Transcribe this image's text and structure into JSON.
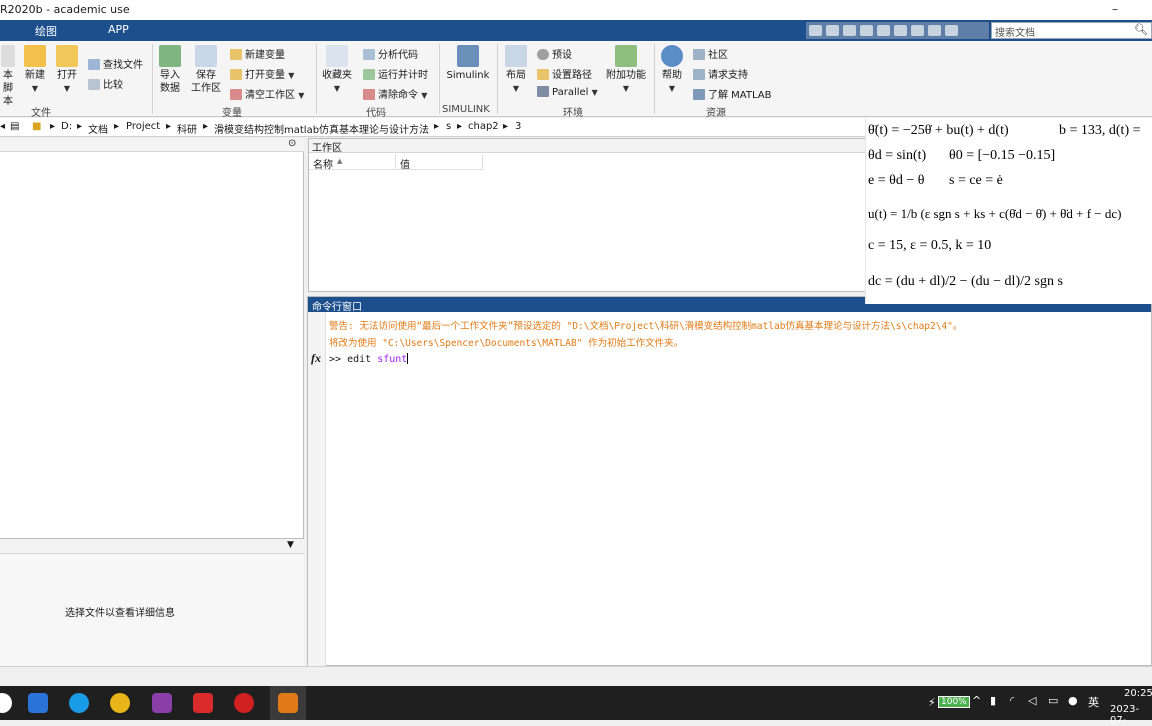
{
  "window": {
    "title": "R2020b - academic use"
  },
  "tabs": [
    "绘图",
    "APP"
  ],
  "search": {
    "placeholder": "搜索文档"
  },
  "ribbon": {
    "groups": {
      "file": {
        "label": "文件",
        "script_partial": "本",
        "script_partial2": "脚本",
        "new": "新建",
        "open": "打开",
        "find_files": "查找文件",
        "compare": "比较"
      },
      "variable": {
        "label": "变量",
        "import": "导入",
        "import2": "数据",
        "save": "保存",
        "save2": "工作区",
        "new_var": "新建变量",
        "open_var": "打开变量",
        "clear_ws": "清空工作区"
      },
      "code": {
        "label": "代码",
        "favorites": "收藏夹",
        "analyze": "分析代码",
        "run_time": "运行并计时",
        "clear_cmd": "清除命令"
      },
      "simulink": {
        "label": "SIMULINK",
        "btn": "Simulink"
      },
      "env": {
        "label": "环境",
        "layout": "布局",
        "prefs": "预设",
        "set_path": "设置路径",
        "parallel": "Parallel",
        "addons": "附加功能"
      },
      "resources": {
        "label": "资源",
        "help": "帮助",
        "community": "社区",
        "support": "请求支持",
        "learn": "了解 MATLAB"
      }
    }
  },
  "address": [
    "D:",
    "文档",
    "Project",
    "科研",
    "滑模变结构控制matlab仿真基本理论与设计方法",
    "s",
    "chap2",
    "3"
  ],
  "workspace": {
    "title": "工作区",
    "col_name": "名称",
    "sort_icon": "▲",
    "col_value": "值"
  },
  "details": {
    "text": "选择文件以查看详细信息"
  },
  "command_window": {
    "title": "命令行窗口",
    "warning1": "警告: 无法访问使用“最后一个工作文件夹”预设选定的 \"D:\\文档\\Project\\科研\\滑模变结构控制matlab仿真基本理论与设计方法\\s\\chap2\\4\"。",
    "warning2": "将改为使用 \"C:\\Users\\Spencer\\Documents\\MATLAB\" 作为初始工作文件夹。",
    "fx": "fx",
    "prompt": ">>",
    "cmd": "edit",
    "arg": "sfunt"
  },
  "formula": {
    "line1a": "θ̈(t) = −25θ̇ + bu(t) + d(t)",
    "line1b": "b = 133, d(t) =",
    "line2a": "θd = sin(t)",
    "line2b": "θ0 = [−0.15   −0.15]",
    "line3a": "e = θd − θ",
    "line3b": "s = ce = ė",
    "line4": "u(t) = 1/b (ε sgn s + ks + c(θ̇d − θ̇) + θ̈d + f − dc)",
    "line5": "c = 15, ε = 0.5, k = 10",
    "line6": "dc = (du + dl)/2 − (du − dl)/2 sgn s"
  },
  "taskbar": {
    "battery": "100%",
    "ime": "英",
    "time": "20:25",
    "date": "2023-07-"
  },
  "colors": {
    "accent": "#1d4f8c",
    "warning": "#e07a16",
    "arg": "#a020f0"
  }
}
